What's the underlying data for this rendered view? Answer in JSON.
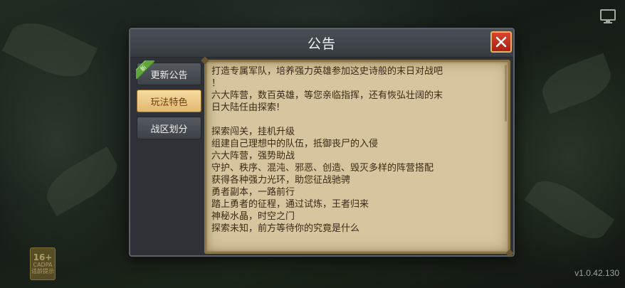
{
  "dialog": {
    "title": "公告",
    "close_glyph": "✕"
  },
  "tabs": [
    {
      "label": "更新公告",
      "badge": "新",
      "active": false
    },
    {
      "label": "玩法特色",
      "active": true
    },
    {
      "label": "战区划分",
      "active": false
    }
  ],
  "content": {
    "lines": [
      "打造专属军队，培养强力英雄参加这史诗般的末日对战吧",
      "！",
      "六大阵营，数百英雄，等您亲临指挥，还有恢弘壮阔的末",
      "日大陆任由探索!",
      "",
      "探索闯关，挂机升级",
      "组建自己理想中的队伍，抵御丧尸的入侵",
      "六大阵营，强势助战",
      "守护、秩序、混沌、邪恶、创造、毁灭多样的阵营搭配",
      "获得各种强力光环，助您征战驰骋",
      "勇者副本，一路前行",
      "踏上勇者的征程，通过试炼，王者归来",
      "神秘水晶，时空之门",
      "探索未知，前方等待你的究竟是什么"
    ]
  },
  "age_rating": {
    "value": "16+",
    "line1": "CADPA",
    "line2": "适龄提示"
  },
  "version": "v1.0.42.130",
  "colors": {
    "parchment": "#d6c59e",
    "active_tab": "#f6dba0",
    "close_button": "#c9321f",
    "new_badge": "#5fa63a"
  },
  "icons": {
    "close": "close-icon",
    "monitor": "monitor-icon"
  }
}
